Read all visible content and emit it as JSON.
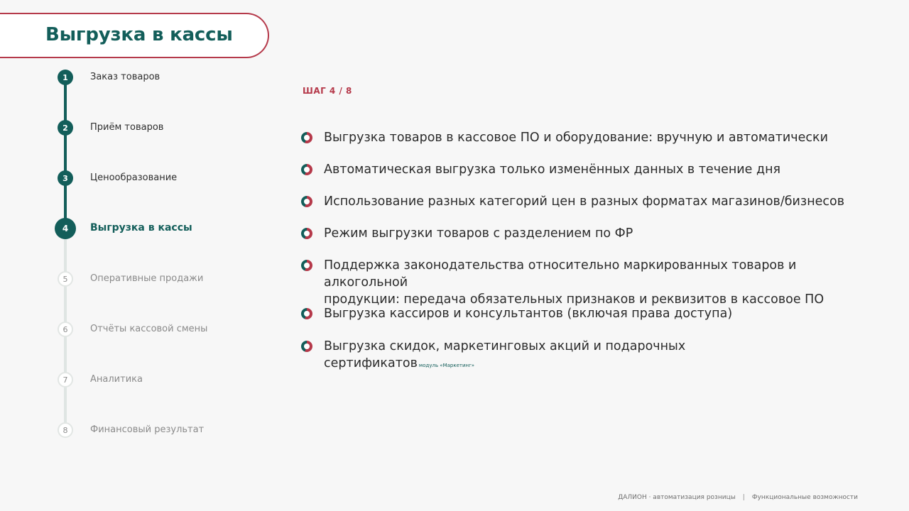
{
  "title": "Выгрузка в кассы",
  "steps": [
    {
      "num": "1",
      "label": "Заказ товаров",
      "state": "done"
    },
    {
      "num": "2",
      "label": "Приём товаров",
      "state": "done"
    },
    {
      "num": "3",
      "label": "Ценообразование",
      "state": "done"
    },
    {
      "num": "4",
      "label": "Выгрузка в кассы",
      "state": "current"
    },
    {
      "num": "5",
      "label": "Оперативные продажи",
      "state": "todo"
    },
    {
      "num": "6",
      "label": "Отчёты кассовой смены",
      "state": "todo"
    },
    {
      "num": "7",
      "label": "Аналитика",
      "state": "todo"
    },
    {
      "num": "8",
      "label": "Финансовый результат",
      "state": "todo"
    }
  ],
  "step_counter": "ШАГ 4 / 8",
  "features": [
    {
      "line1": "Выгрузка товаров в кассовое ПО и оборудование: вручную и автоматически",
      "line2": "",
      "note": ""
    },
    {
      "line1": "Автоматическая выгрузка только изменённых данных в течение дня",
      "line2": "",
      "note": ""
    },
    {
      "line1": "Использование разных категорий цен в разных форматах магазинов/бизнесов",
      "line2": "",
      "note": ""
    },
    {
      "line1": "Режим выгрузки товаров с разделением по ФР",
      "line2": "",
      "note": ""
    },
    {
      "line1": "Поддержка законодательства относительно маркированных товаров и алкогольной",
      "line2": "продукции: передача обязательных признаков и реквизитов в кассовое ПО",
      "note": ""
    },
    {
      "line1": "Выгрузка кассиров и консультантов (включая права доступа)",
      "line2": "",
      "note": ""
    },
    {
      "line1": "Выгрузка скидок, маркетинговых акций и подарочных",
      "line2": "сертификатов",
      "note": "модуль «Маркетинг»"
    }
  ],
  "footer": {
    "left": "ДАЛИОН · автоматизация розницы",
    "separator": "|",
    "right": "Функциональные возможности"
  },
  "colors": {
    "primary": "#135e5a",
    "accent": "#b5394a",
    "background": "#f7f7f7"
  }
}
